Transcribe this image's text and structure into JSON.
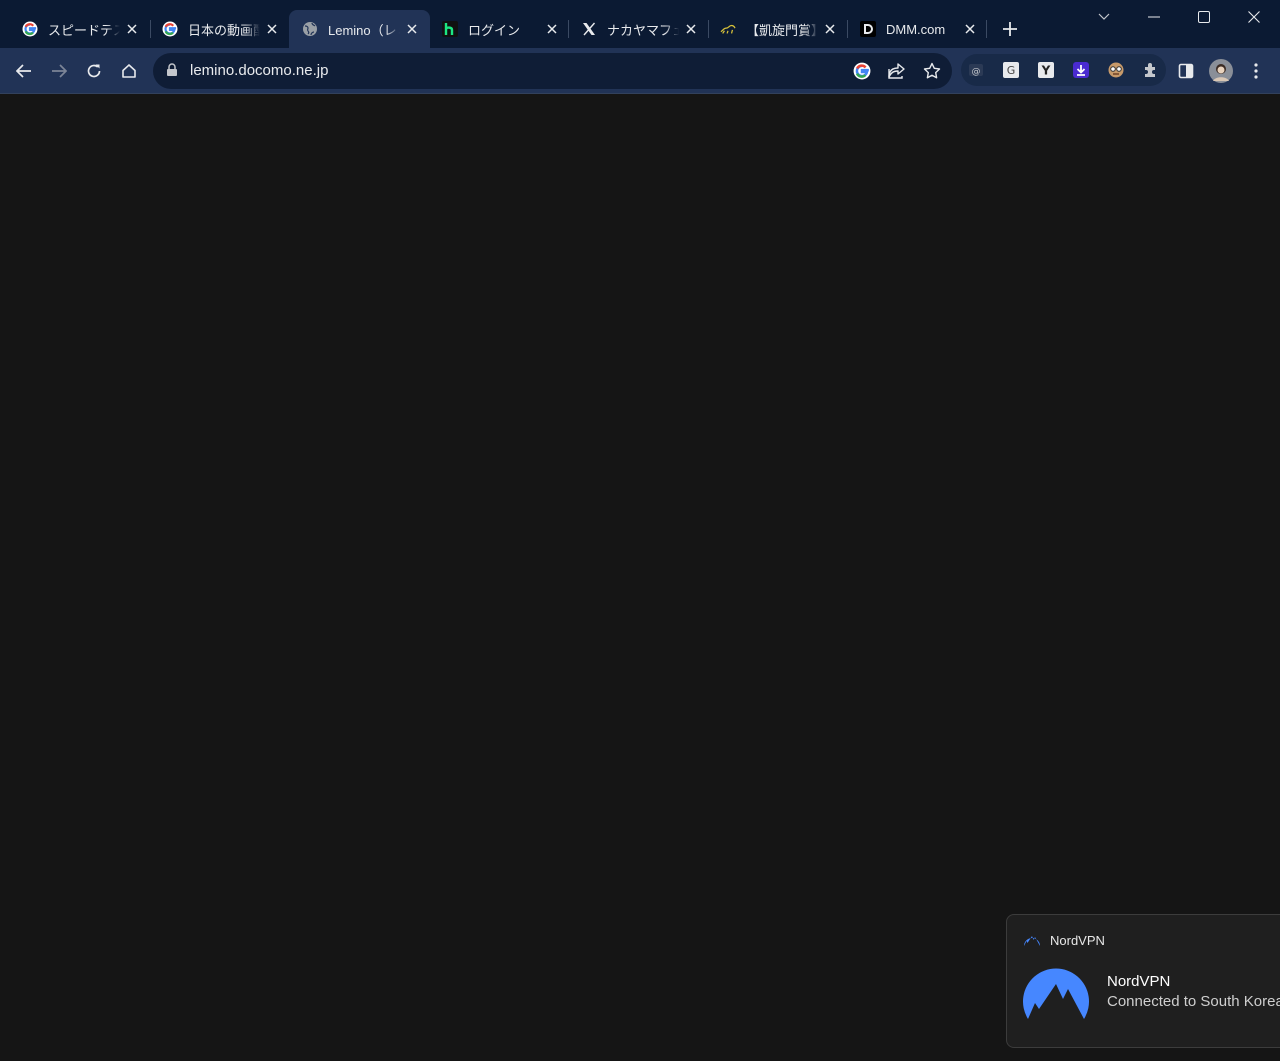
{
  "tabs": [
    {
      "title": "スピードテスト",
      "icon": "google-icon"
    },
    {
      "title": "日本の動画配信",
      "icon": "google-icon"
    },
    {
      "title": "Lemino（レミノ）",
      "icon": "globe-icon",
      "active": true
    },
    {
      "title": "ログイン",
      "icon": "hulu-h-icon"
    },
    {
      "title": "ナカヤマフェスタ",
      "icon": "x-icon"
    },
    {
      "title": "【凱旋門賞】",
      "icon": "horse-racing-icon"
    },
    {
      "title": "DMM.com",
      "icon": "dmm-icon"
    }
  ],
  "address_bar": {
    "url": "lemino.docomo.ne.jp"
  },
  "colors": {
    "tabstrip": "#0b1a33",
    "toolbar": "#213356",
    "page_background": "#151515",
    "nordvpn_blue": "#4687ff"
  },
  "extensions": [
    "mail-extension-icon",
    "google-translate-extension-icon",
    "yahoo-extension-icon",
    "download-extension-icon",
    "face-extension-icon",
    "puzzle-extensions-icon"
  ],
  "notification": {
    "app_name": "NordVPN",
    "title": "NordVPN",
    "body": "Connected to South Korea"
  }
}
